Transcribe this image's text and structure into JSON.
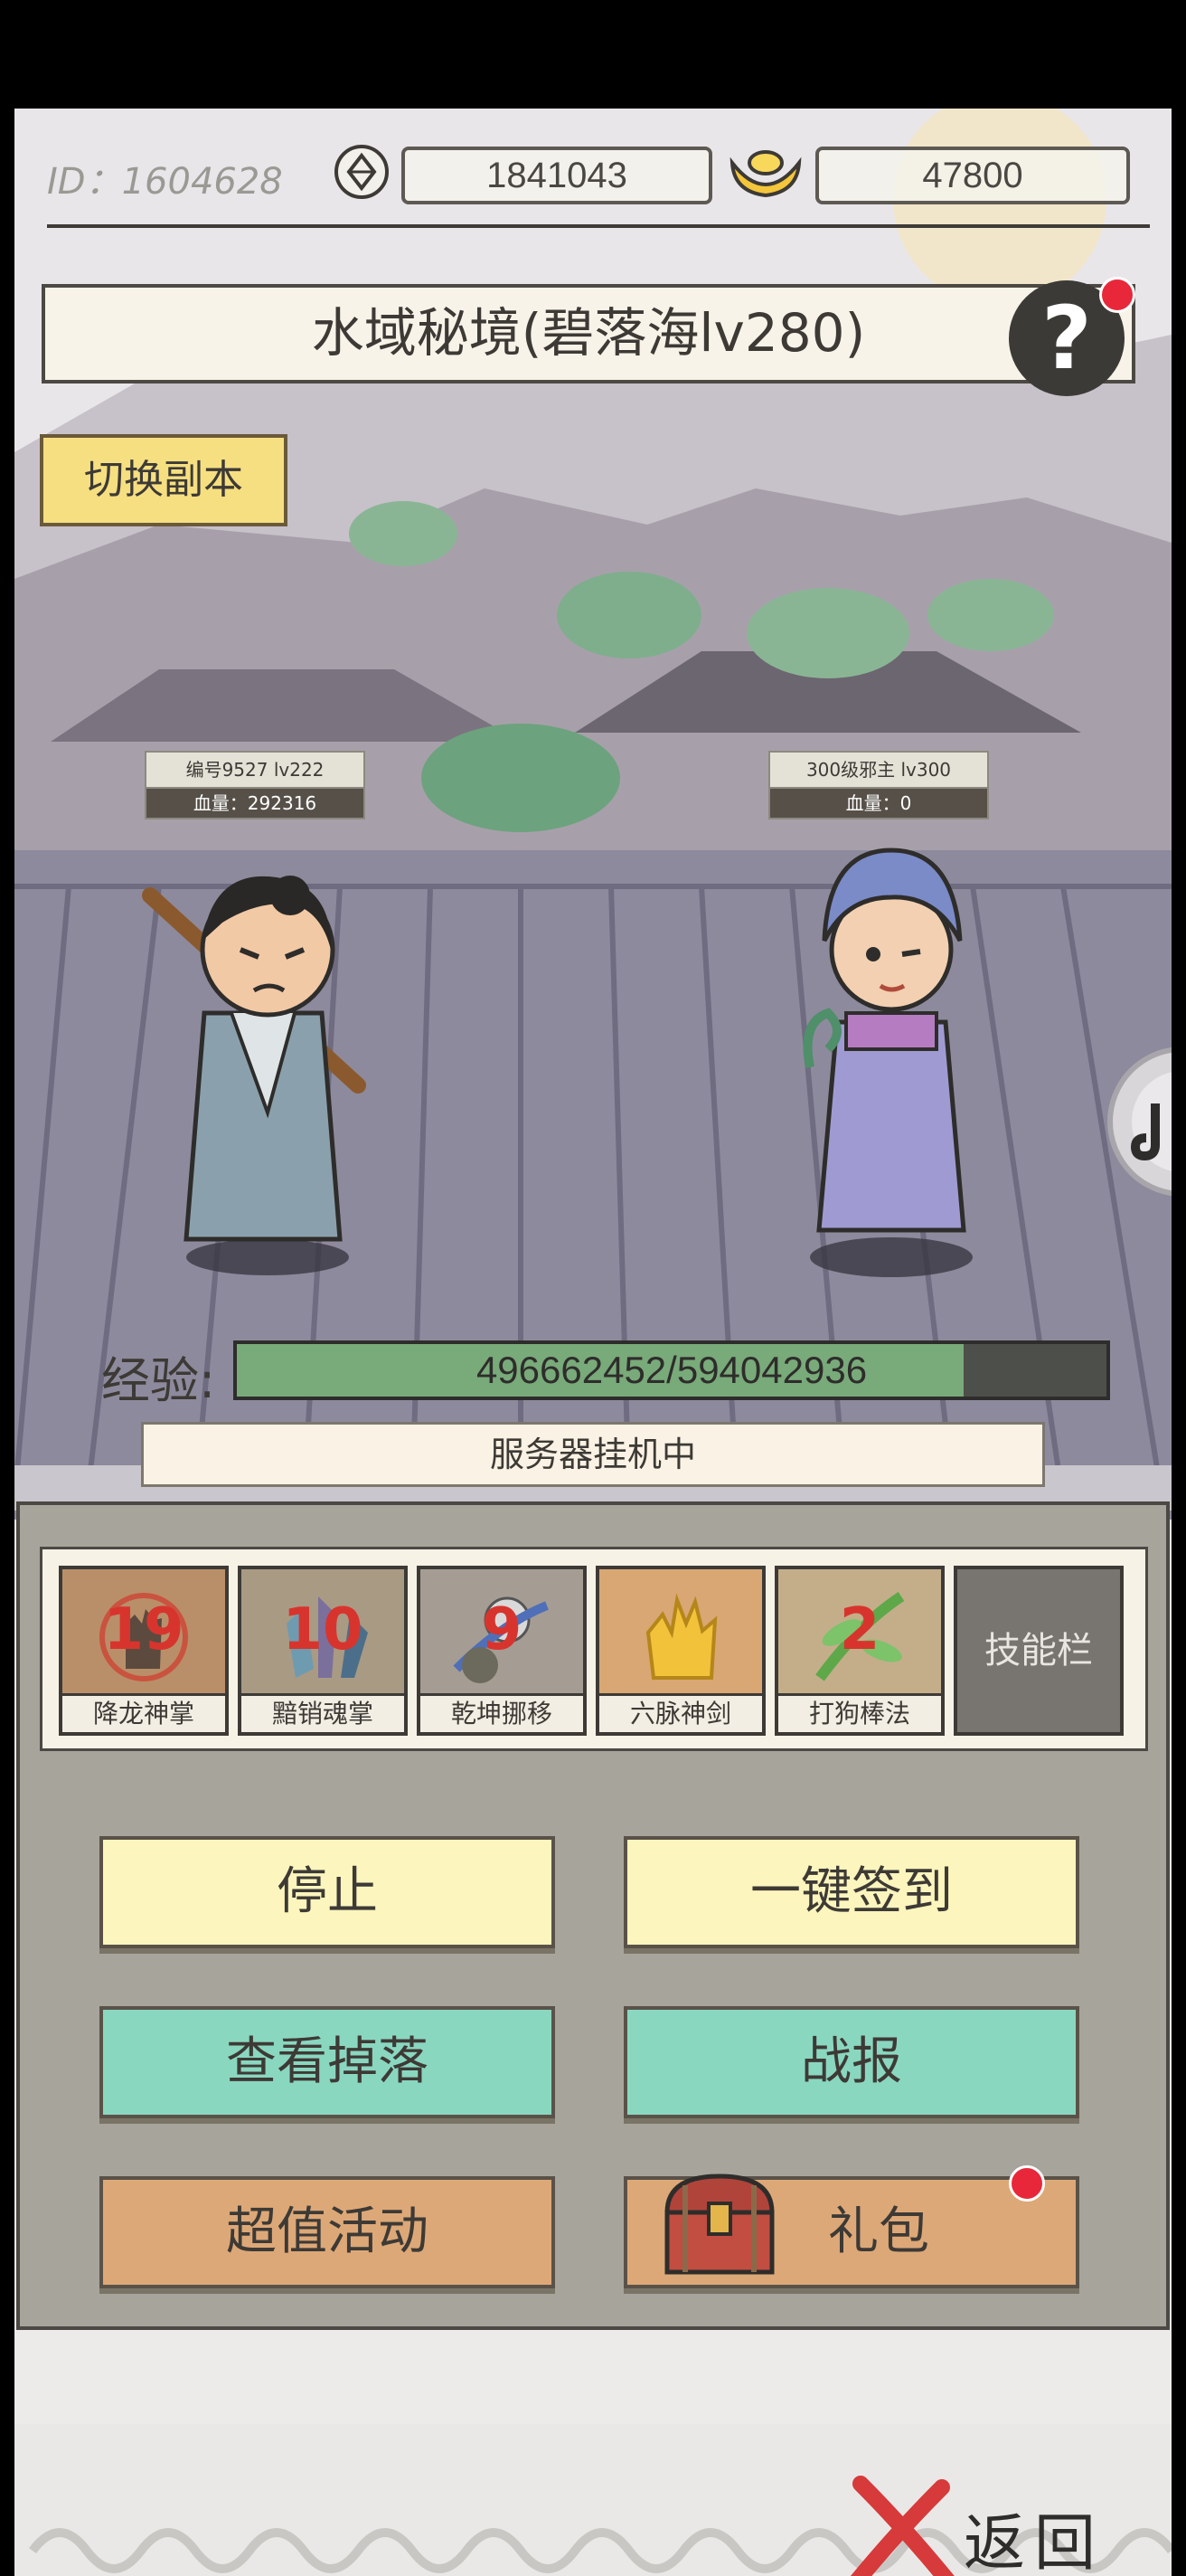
{
  "top_bar": {
    "player_id": "ID：1604628",
    "gems": "1841043",
    "gold": "47800"
  },
  "title": "水域秘境(碧落海lv280)",
  "help_label": "?",
  "switch_dungeon": "切换副本",
  "battle": {
    "player": {
      "name": "编号9527  lv222",
      "hp": "血量：292316"
    },
    "enemy": {
      "name": "300级邪主  lv300",
      "hp": "血量：0"
    }
  },
  "experience": {
    "label": "经验:",
    "text": "496662452/594042936",
    "current": 496662452,
    "max": 594042936
  },
  "status": "服务器挂机中",
  "skills": [
    {
      "label": "降龙神掌",
      "level": "19",
      "color": "#b98f6a",
      "icon": "palm-icon"
    },
    {
      "label": "黯销魂掌",
      "level": "10",
      "color": "#a99a84",
      "icon": "crystal-icon"
    },
    {
      "label": "乾坤挪移",
      "level": "9",
      "color": "#a59d93",
      "icon": "swirl-icon"
    },
    {
      "label": "六脉神剑",
      "level": "",
      "color": "#d8a774",
      "icon": "golden-hand-icon"
    },
    {
      "label": "打狗棒法",
      "level": "2",
      "color": "#c4ae8a",
      "icon": "green-staff-icon"
    }
  ],
  "skill_slot_label": "技能栏",
  "buttons": {
    "stop": "停止",
    "checkin": "一键签到",
    "drops": "查看掉落",
    "battle_report": "战报",
    "event": "超值活动",
    "gift": "礼包"
  },
  "back_label": "返回"
}
